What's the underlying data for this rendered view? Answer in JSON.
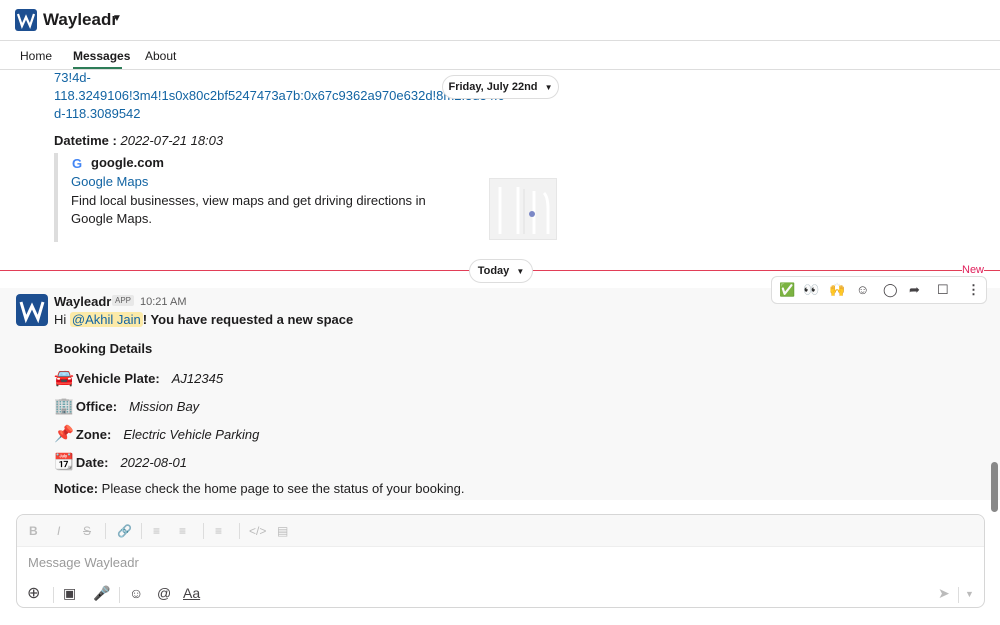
{
  "app": {
    "name": "Wayleadr"
  },
  "tabs": [
    {
      "label": "Home"
    },
    {
      "label": "Messages"
    },
    {
      "label": "About"
    }
  ],
  "earlier_message": {
    "link_line_1": "73!4d-",
    "link_line_2": "118.3249106!3m4!1s0x80c2bf5247473a7b:0x67c9362a970e632d!8m2!3d34.0",
    "link_line_3": "d-118.3089542",
    "datetime_label": "Datetime :",
    "datetime_value": "2022-07-21 18:03",
    "preview": {
      "site": "google.com",
      "title": "Google Maps",
      "description": "Find local businesses, view maps and get driving directions in Google Maps."
    }
  },
  "date_pills": {
    "past": "Friday, July 22nd",
    "today": "Today"
  },
  "new_label": "New",
  "message": {
    "sender": "Wayleadr",
    "badge": "APP",
    "time": "10:21 AM",
    "greeting_prefix": "Hi ",
    "mention": "@Akhil Jain",
    "greeting_suffix": "! You have requested a new space",
    "section_title": "Booking Details",
    "fields": [
      {
        "emoji": "🚘",
        "label": "Vehicle Plate:",
        "value": "AJ12345"
      },
      {
        "emoji": "🏢",
        "label": "Office:",
        "value": "Mission Bay"
      },
      {
        "emoji": "📌",
        "label": "Zone:",
        "value": "Electric Vehicle Parking"
      },
      {
        "emoji": "📆",
        "label": "Date:",
        "value": "2022-08-01"
      }
    ],
    "notice_label": "Notice:",
    "notice_text": " Please check the home page to see the status of your booking."
  },
  "composer": {
    "placeholder": "Message Wayleadr",
    "text_format_label": "Aa"
  },
  "colors": {
    "brand": "#1d4f91",
    "link": "#1264a3",
    "new_divider": "#e23e57",
    "active_tab": "#2e7d58"
  }
}
